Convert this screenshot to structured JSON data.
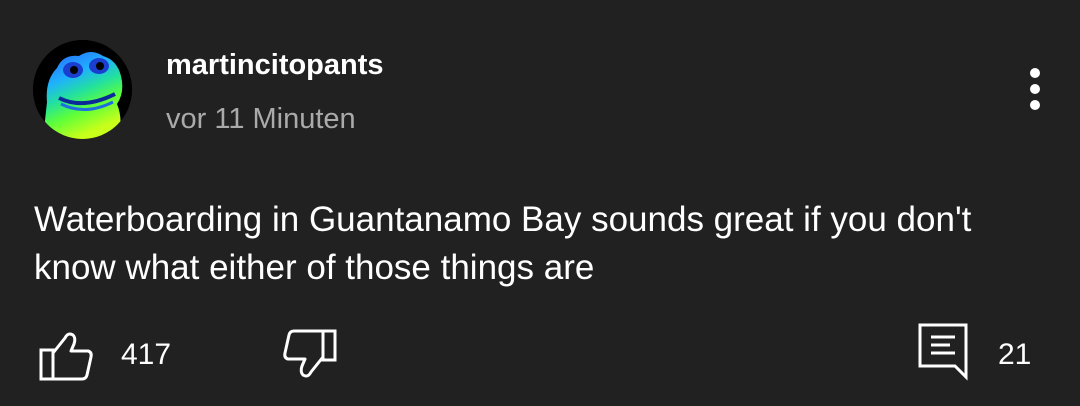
{
  "comment": {
    "author": "martincitopants",
    "timestamp": "vor 11 Minuten",
    "text": "Waterboarding in Guantanamo Bay sounds great if you don't know what either of those things are",
    "like_count": "417",
    "reply_count": "21"
  },
  "icons": {
    "avatar": "frog-avatar",
    "more": "more-vertical-icon",
    "like": "thumbs-up-icon",
    "dislike": "thumbs-down-icon",
    "reply": "reply-comment-icon"
  },
  "colors": {
    "background": "#212121",
    "text_primary": "#ffffff",
    "text_secondary": "#aaaaaa"
  }
}
